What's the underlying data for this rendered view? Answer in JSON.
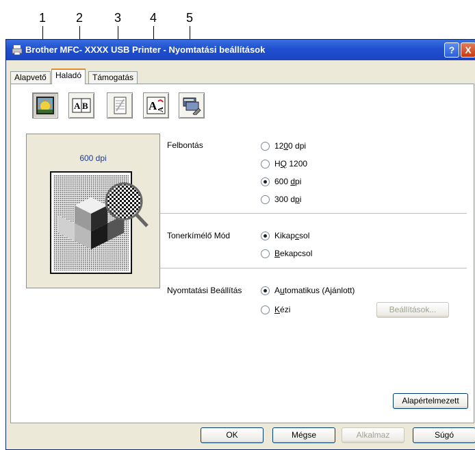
{
  "callouts": [
    "1",
    "2",
    "3",
    "4",
    "5"
  ],
  "window": {
    "title": "Brother MFC- XXXX   USB Printer - Nyomtatási beállítások",
    "help_button": "?",
    "close_button": "X"
  },
  "tabs": [
    {
      "label": "Alapvető",
      "active": false
    },
    {
      "label": "Haladó",
      "active": true
    },
    {
      "label": "Támogatás",
      "active": false
    }
  ],
  "toolbar": [
    {
      "name": "quality-icon",
      "pressed": true
    },
    {
      "name": "duplex-icon",
      "pressed": false
    },
    {
      "name": "watermark-icon",
      "pressed": false
    },
    {
      "name": "page-setting-icon",
      "pressed": false
    },
    {
      "name": "device-options-icon",
      "pressed": false
    }
  ],
  "preview": {
    "label": "600 dpi"
  },
  "resolution": {
    "label": "Felbontás",
    "options": [
      {
        "pre": "12",
        "u": "0",
        "post": "0 dpi",
        "checked": false
      },
      {
        "pre": "H",
        "u": "Q",
        "post": " 1200",
        "checked": false
      },
      {
        "pre": "600 ",
        "u": "d",
        "post": "pi",
        "checked": true
      },
      {
        "pre": "300 d",
        "u": "p",
        "post": "i",
        "checked": false
      }
    ]
  },
  "toner": {
    "label": "Tonerkímélő Mód",
    "options": [
      {
        "pre": "Kikap",
        "u": "c",
        "post": "sol",
        "checked": true
      },
      {
        "pre": "",
        "u": "B",
        "post": "ekapcsol",
        "checked": false
      }
    ]
  },
  "print_setting": {
    "label": "Nyomtatási Beállítás",
    "options": [
      {
        "pre": "A",
        "u": "u",
        "post": "tomatikus (Ajánlott)",
        "checked": true
      },
      {
        "pre": "",
        "u": "K",
        "post": "ézi",
        "checked": false
      }
    ],
    "settings_button": "Beállítások..."
  },
  "default_button": "Alapértelmezett",
  "footer": {
    "ok": "OK",
    "cancel": "Mégse",
    "apply": "Alkalmaz",
    "help": "Súgó"
  }
}
